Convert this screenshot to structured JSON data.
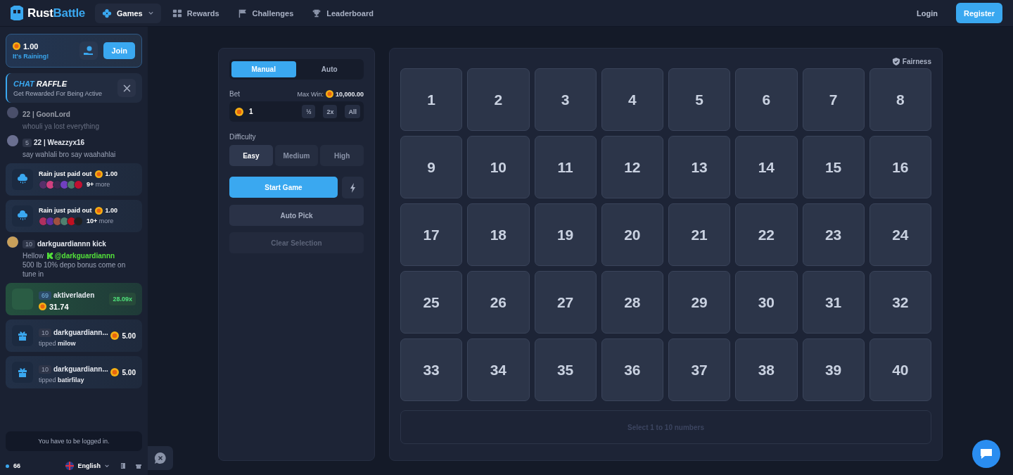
{
  "header": {
    "logo": {
      "part_1": "Rust",
      "part_2": "Battle"
    },
    "nav": [
      {
        "label": "Games",
        "selected": true,
        "dropdown": true
      },
      {
        "label": "Rewards",
        "selected": false,
        "dropdown": false
      },
      {
        "label": "Challenges",
        "selected": false,
        "dropdown": false
      },
      {
        "label": "Leaderboard",
        "selected": false,
        "dropdown": false
      }
    ],
    "login": "Login",
    "register": "Register"
  },
  "sidebar": {
    "rain": {
      "amount": "1.00",
      "label": "It's Raining!",
      "button": "Join"
    },
    "raffle": {
      "title_1": "CHAT",
      "title_2": "RAFFLE",
      "subtitle": "Get Rewarded For Being Active"
    },
    "feed": [
      {
        "kind": "chat",
        "faded": true,
        "name": "22 | GoonLord",
        "text": "whouli ya lost everything"
      },
      {
        "kind": "chat",
        "faded": false,
        "level": "5",
        "name": "22 | Weazzyx16",
        "text": "say wahlali bro say waahahlai"
      },
      {
        "kind": "rain",
        "label": "Rain just paid out",
        "amount": "1.00",
        "more_count": "9+",
        "more_label": "more"
      },
      {
        "kind": "rain",
        "label": "Rain just paid out",
        "amount": "1.00",
        "more_count": "10+",
        "more_label": "more"
      },
      {
        "kind": "chat",
        "faded": false,
        "level": "10",
        "name": "darkguardiannn kick",
        "text": "Hellow",
        "mention": "@darkguardiannn",
        "text_after": "500 lb 10% depo bonus come on tune in"
      },
      {
        "kind": "win",
        "level": "69",
        "name": "aktiverladen",
        "amount": "31.74",
        "multiplier": "28.09x"
      },
      {
        "kind": "tip",
        "level": "10",
        "name": "darkguardiann...",
        "verb": "tipped",
        "target": "milow",
        "amount": "5.00"
      },
      {
        "kind": "tip",
        "level": "10",
        "name": "darkguardiann...",
        "verb": "tipped",
        "target": "batirfilay",
        "amount": "5.00"
      }
    ],
    "login_notice": "You have to be logged in.",
    "footer": {
      "online": "66",
      "language": "English"
    }
  },
  "controls": {
    "modes": [
      {
        "label": "Manual",
        "selected": true
      },
      {
        "label": "Auto",
        "selected": false
      }
    ],
    "bet": {
      "label": "Bet",
      "max_win_label": "Max Win:",
      "max_win": "10,000.00",
      "value": "1",
      "buttons": [
        "½",
        "2x",
        "All"
      ]
    },
    "difficulty": {
      "label": "Difficulty",
      "options": [
        {
          "label": "Easy",
          "selected": true
        },
        {
          "label": "Medium",
          "selected": false
        },
        {
          "label": "High",
          "selected": false
        }
      ]
    },
    "start": "Start Game",
    "auto_pick": {
      "label": "Auto Pick",
      "disabled": false
    },
    "clear": {
      "label": "Clear Selection",
      "disabled": true
    }
  },
  "board": {
    "fairness": "Fairness",
    "tiles": [
      "1",
      "2",
      "3",
      "4",
      "5",
      "6",
      "7",
      "8",
      "9",
      "10",
      "11",
      "12",
      "13",
      "14",
      "15",
      "16",
      "17",
      "18",
      "19",
      "20",
      "21",
      "22",
      "23",
      "24",
      "25",
      "26",
      "27",
      "28",
      "29",
      "30",
      "31",
      "32",
      "33",
      "34",
      "35",
      "36",
      "37",
      "38",
      "39",
      "40"
    ],
    "hint": "Select 1 to 10 numbers"
  }
}
